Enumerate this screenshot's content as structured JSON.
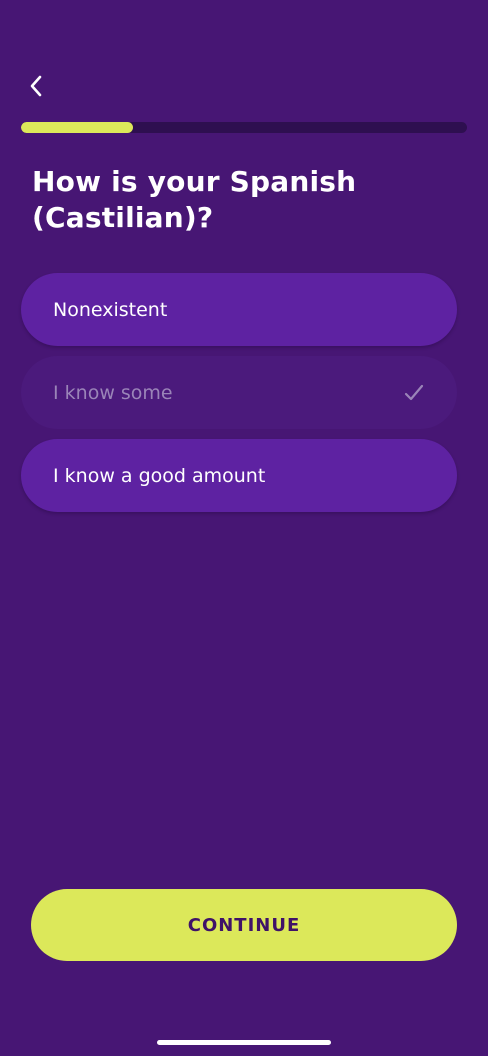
{
  "header": {
    "back_icon": "chevron-left-icon",
    "progress_fraction": 0.25
  },
  "question": {
    "title": "How is your Spanish (Castilian)?"
  },
  "options": [
    {
      "label": "Nonexistent",
      "selected": false
    },
    {
      "label": "I know some",
      "selected": true,
      "icon": "checkmark-icon"
    },
    {
      "label": "I know a good amount",
      "selected": false
    }
  ],
  "footer": {
    "continue_label": "CONTINUE"
  },
  "colors": {
    "background": "#471674",
    "option": "#5e22a2",
    "option_selected": "#4b1a7c",
    "accent": "#dce85a",
    "progress_track": "#2e0f50",
    "button_text": "#3f1268"
  }
}
